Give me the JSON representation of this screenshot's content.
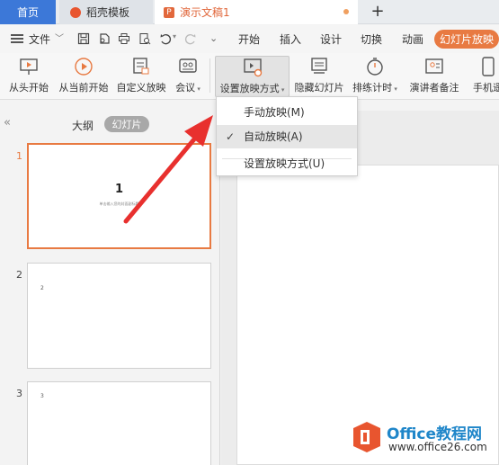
{
  "tabs": {
    "home": "首页",
    "straw": "稻壳模板",
    "doc": "演示文稿1",
    "add": "+"
  },
  "menubar": {
    "file": "文件",
    "items": [
      "开始",
      "插入",
      "设计",
      "切换",
      "动画"
    ],
    "active": "幻灯片放映"
  },
  "ribbon": {
    "from_start": "从头开始",
    "from_current": "从当前开始",
    "custom_show": "自定义放映",
    "meeting": "会议",
    "setup_show": "设置放映方式",
    "hide_slide": "隐藏幻灯片",
    "rehearse": "排练计时",
    "presenter_notes": "演讲者备注",
    "phone": "手机遥"
  },
  "leftpanel": {
    "outline": "大纲",
    "slides": "幻灯片",
    "thumbs": [
      {
        "num": "1",
        "title": "1",
        "sub": "单击输入您的封面副标题"
      },
      {
        "num": "2",
        "text": "2"
      },
      {
        "num": "3",
        "text": "3"
      }
    ]
  },
  "dropdown": {
    "items": [
      {
        "label": "手动放映(M)",
        "checked": false
      },
      {
        "label": "自动放映(A)",
        "checked": true
      },
      {
        "label": "设置放映方式(U)",
        "checked": false
      }
    ],
    "check": "✓"
  },
  "watermark": {
    "text": "Office教程网",
    "url": "www.office26.com"
  },
  "colors": {
    "accent": "#e87a42",
    "home_tab": "#3c78d8",
    "arrow": "#e8302e"
  }
}
